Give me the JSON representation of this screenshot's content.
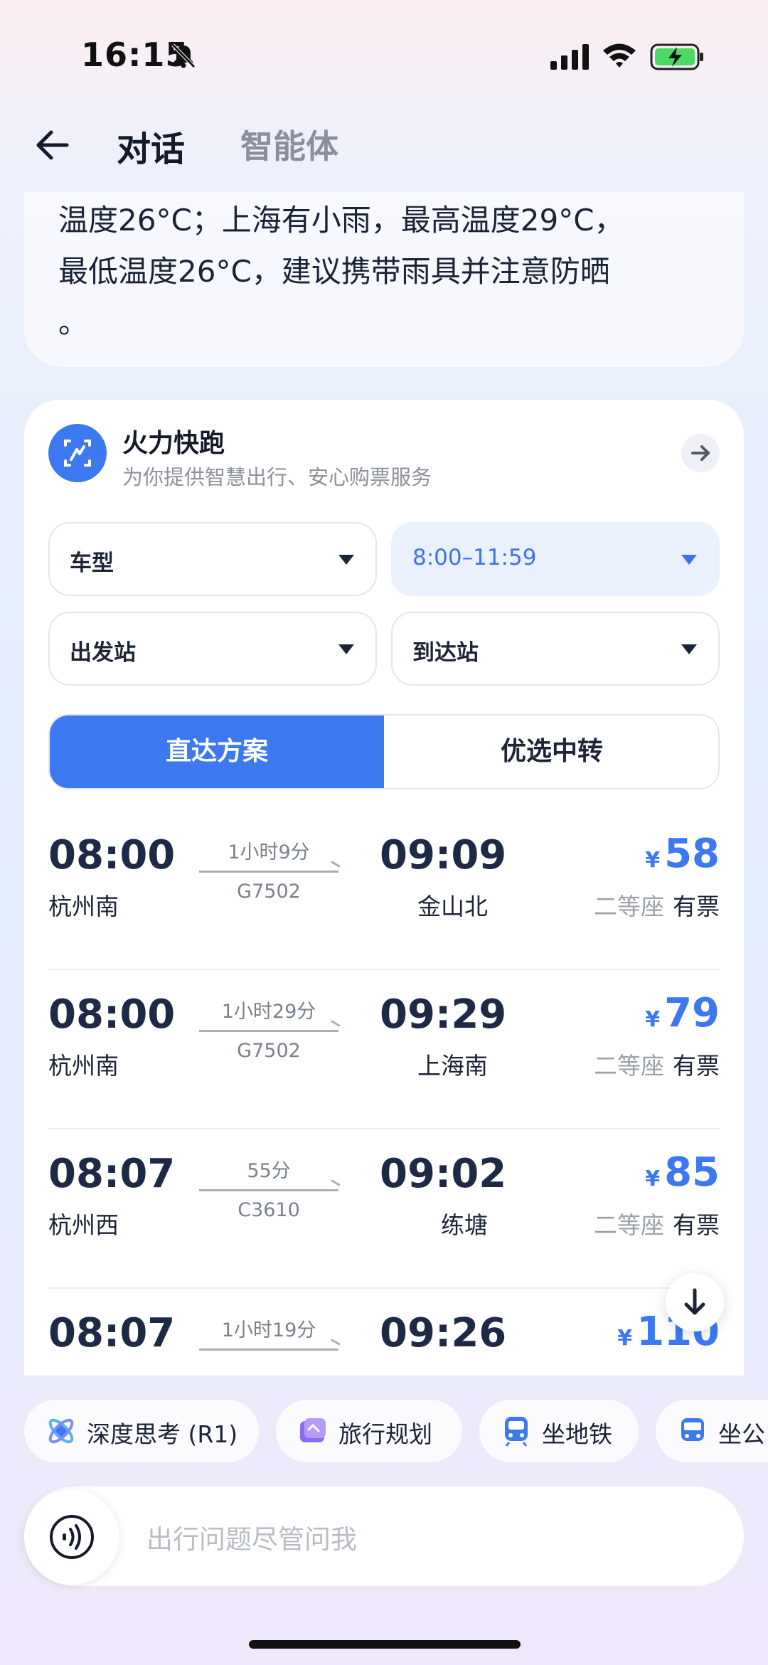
{
  "status_bar": {
    "time": "16:15"
  },
  "header": {
    "tab_dialog": "对话",
    "tab_agent": "智能体"
  },
  "previous_message": {
    "line1": "温度26°C；上海有小雨，最高温度29°C，",
    "line2": "最低温度26°C，建议携带雨具并注意防晒",
    "line3": "。"
  },
  "card": {
    "app_name": "火力快跑",
    "app_desc": "为你提供智慧出行、安心购票服务",
    "filters": {
      "train_type": "车型",
      "time_range": "8:00–11:59",
      "departure_station": "出发站",
      "arrival_station": "到达站"
    },
    "segments": {
      "direct": "直达方案",
      "transfer": "优选中转"
    },
    "trains": [
      {
        "dep_time": "08:00",
        "dep_station": "杭州南",
        "duration": "1小时9分",
        "train_no": "G7502",
        "arr_time": "09:09",
        "arr_station": "金山北",
        "currency": "¥",
        "price": "58",
        "seat_class": "二等座",
        "availability": "有票"
      },
      {
        "dep_time": "08:00",
        "dep_station": "杭州南",
        "duration": "1小时29分",
        "train_no": "G7502",
        "arr_time": "09:29",
        "arr_station": "上海南",
        "currency": "¥",
        "price": "79",
        "seat_class": "二等座",
        "availability": "有票"
      },
      {
        "dep_time": "08:07",
        "dep_station": "杭州西",
        "duration": "55分",
        "train_no": "C3610",
        "arr_time": "09:02",
        "arr_station": "练塘",
        "currency": "¥",
        "price": "85",
        "seat_class": "二等座",
        "availability": "有票"
      },
      {
        "dep_time": "08:07",
        "dep_station": "",
        "duration": "1小时19分",
        "train_no": "",
        "arr_time": "09:26",
        "arr_station": "",
        "currency": "¥",
        "price": "110",
        "seat_class": "",
        "availability": ""
      }
    ]
  },
  "chips": [
    {
      "label": "深度思考 (R1)",
      "icon": "deep-think-icon"
    },
    {
      "label": "旅行规划",
      "icon": "travel-plan-icon"
    },
    {
      "label": "坐地铁",
      "icon": "metro-icon"
    },
    {
      "label": "坐公",
      "icon": "bus-icon"
    }
  ],
  "input": {
    "placeholder": "出行问题尽管问我"
  },
  "colors": {
    "accent": "#3c78f0",
    "accent_light": "#ebf0fd",
    "text_dark": "#1e2a45",
    "text_muted": "#8c919c"
  }
}
